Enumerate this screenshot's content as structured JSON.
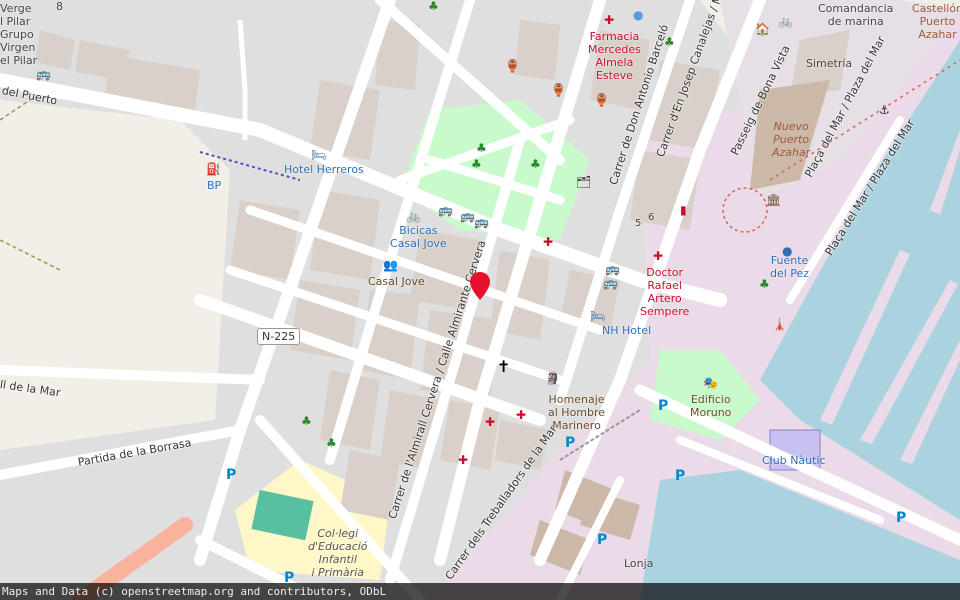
{
  "streets": {
    "del_puerto": "del Puerto",
    "de_la_mar": "ll de la Mar",
    "borrasa": "Partida de la Borrasa",
    "almirall": "Carrer de l'Almirall Cervera / Calle Almirante Cervera",
    "treballadors": "Carrer dels Treballadors de la Mar",
    "antonio_barcelo": "Carrer de Don Antonio Barceló",
    "josep_canalejas": "Carrer d'En Josep Canalejas / Me",
    "bona_vista": "Passeig de Bona Vista",
    "placa_mar_1": "Plaça del Mar / Plaza del Mar",
    "placa_mar_2": "Plaça del Mar / Plaza del Mar"
  },
  "road_shield": "N-225",
  "labels": {
    "verge": "Verge\nl Pilar\nGrupo\nVirgen\nel Pilar",
    "num_8": "8",
    "hotel_herreros": "Hotel Herreros",
    "bp": "BP",
    "bicicas": "Bicicas\nCasal Jove",
    "casal_jove": "Casal Jove",
    "farmacia": "Farmacia\nMercedes\nAlmela\nEsteve",
    "doctor": "Doctor\nRafael\nArtero\nSempere",
    "nh_hotel": "NH Hotel",
    "homenaje": "Homenaje\nal Hombre\nMarinero",
    "edificio": "Edificio\nMoruno",
    "fuente": "Fuente\ndel Pez",
    "club": "Club Nàutic",
    "comandancia": "Comandancia\nde marina",
    "castellon": "Castellón\nPuerto\nAzahar",
    "simetria": "Simetría",
    "nuevo_puerto": "Nuevo\nPuerto\nAzahar",
    "colegi": "Col·legi\nd'Educació\nInfantil\ni Primària",
    "lonja": "Lonja",
    "num_5": "5",
    "num_6": "6"
  },
  "attribution": "Maps and Data (c) openstreetmap.org and contributors, ODbL",
  "parking_letter": "P",
  "colors": {
    "water": "#aad3df",
    "park": "#c8facc",
    "road": "#ffffff",
    "building": "#d9d0c9",
    "industrial": "#ebdbe8",
    "marker": "#e8112d",
    "trunk": "#f9b29c"
  }
}
